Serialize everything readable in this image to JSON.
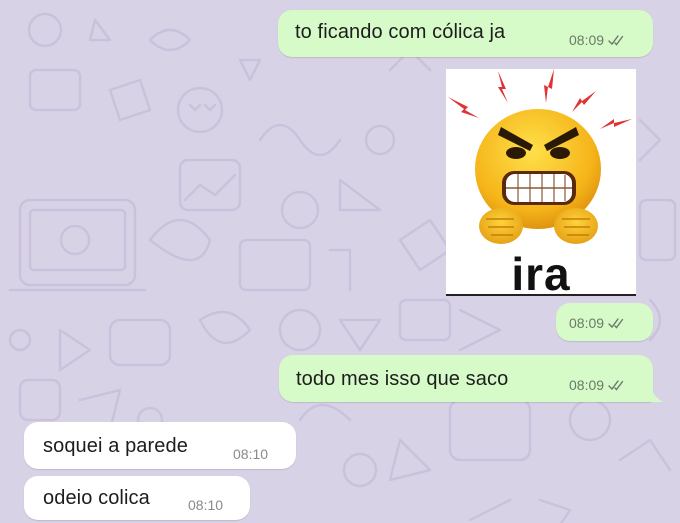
{
  "chat": {
    "messages": [
      {
        "direction": "outgoing",
        "text": "to ficando com cólica ja",
        "time": "08:09",
        "status": "read"
      },
      {
        "direction": "outgoing",
        "type": "sticker",
        "sticker_caption": "ira",
        "time": "08:09",
        "status": "read"
      },
      {
        "direction": "outgoing",
        "text": "todo mes isso que saco",
        "time": "08:09",
        "status": "read"
      },
      {
        "direction": "incoming",
        "text": "soquei a parede",
        "time": "08:10"
      },
      {
        "direction": "incoming",
        "text": "odeio colica",
        "time": "08:10"
      }
    ]
  },
  "colors": {
    "wallpaper": "#d8d2e6",
    "outgoing_bubble": "#d7fbc8",
    "incoming_bubble": "#ffffff"
  },
  "icons": {
    "read_receipt": "double-check-icon",
    "sticker": "angry-emoji-sticker"
  }
}
